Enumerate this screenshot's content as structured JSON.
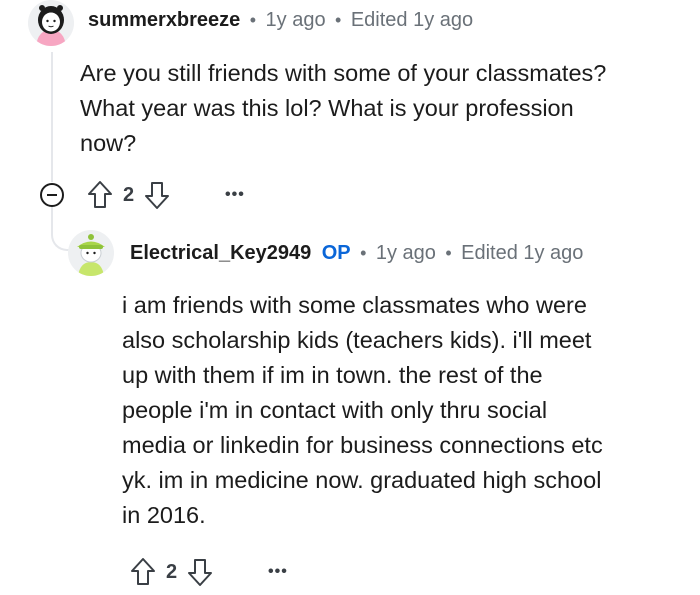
{
  "comment1": {
    "username": "summerxbreeze",
    "timestamp": "1y ago",
    "edited": "Edited 1y ago",
    "body_lines": [
      "Are you still friends with some of your classmates?",
      "What year was this lol? What is your profession",
      "now?"
    ],
    "vote_count": "2",
    "more": "•••"
  },
  "comment2": {
    "username": "Electrical_Key2949",
    "op_badge": "OP",
    "timestamp": "1y ago",
    "edited": "Edited 1y ago",
    "body_lines": [
      "i am friends with some classmates who were",
      "also scholarship kids (teachers kids). i'll meet",
      "up with them if im in town. the rest of the",
      "people i'm in contact with only thru social",
      "media or linkedin for business connections etc",
      "yk. im in medicine now. graduated high school",
      "in 2016."
    ],
    "vote_count": "2",
    "more": "•••"
  },
  "separator": "•",
  "icons": [
    "avatar-girl-icon",
    "avatar-green-hat-icon",
    "collapse-minus-icon",
    "upvote-arrow-icon",
    "downvote-arrow-icon",
    "more-options-icon"
  ],
  "colors": {
    "op_blue": "#0a66d8",
    "meta_gray": "#6a7178",
    "thread_line": "#e5e7eb"
  }
}
